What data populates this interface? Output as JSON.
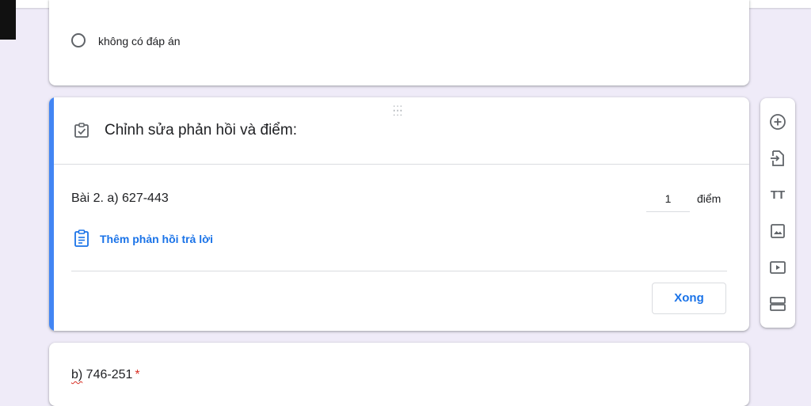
{
  "top_card": {
    "option_label": "không có đáp án"
  },
  "answer_key_card": {
    "header_title": "Chỉnh sửa phản hồi và điểm:",
    "question_text": "Bài 2. a) 627-443",
    "points_value": "1",
    "points_unit": "điểm",
    "add_feedback_label": "Thêm phản hồi trả lời",
    "done_label": "Xong"
  },
  "next_question": {
    "text_prefix": "b)",
    "text_rest": " 746-251",
    "required_mark": "*"
  },
  "side_toolbar": {
    "icons": [
      "add-question-icon",
      "import-questions-icon",
      "add-title-icon",
      "add-image-icon",
      "add-video-icon",
      "add-section-icon"
    ],
    "title_glyph": "TT"
  },
  "colors": {
    "accent_blue": "#4285f4",
    "link_blue": "#1a73e8",
    "brand_purple": "#673ab7",
    "background": "#efebf8",
    "required_red": "#d93025"
  }
}
